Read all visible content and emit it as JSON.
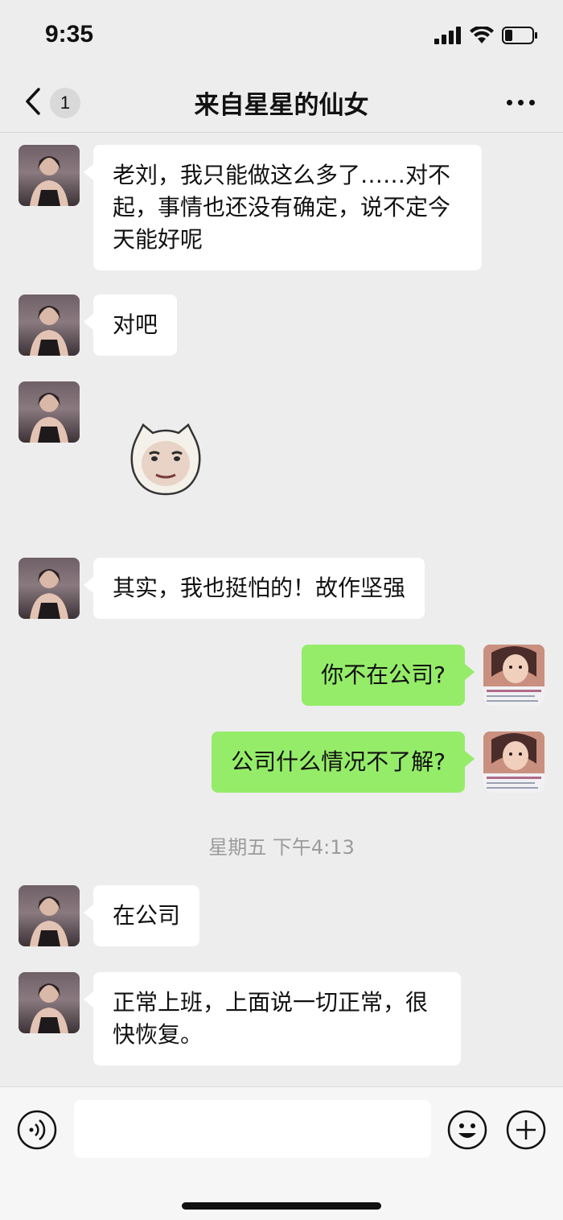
{
  "status_bar": {
    "time": "9:35"
  },
  "nav": {
    "back_count": "1",
    "title": "来自星星的仙女"
  },
  "messages": [
    {
      "side": "in",
      "text": "老刘，我只能做这么多了……对不起，事情也还没有确定，说不定今天能好呢"
    },
    {
      "side": "in",
      "text": "对吧"
    },
    {
      "side": "in",
      "type": "sticker"
    },
    {
      "side": "in",
      "text": "其实，我也挺怕的！故作坚强"
    },
    {
      "side": "out",
      "text": "你不在公司?"
    },
    {
      "side": "out",
      "text": "公司什么情况不了解?"
    },
    {
      "side": "in",
      "text": "在公司"
    },
    {
      "side": "in",
      "text": "正常上班，上面说一切正常，很快恢复。"
    }
  ],
  "timestamp": "星期五 下午4:13",
  "input": {
    "placeholder": ""
  },
  "colors": {
    "background": "#ededed",
    "bubble_out": "#95ec69",
    "bubble_in": "#ffffff"
  },
  "icons": [
    "back-icon",
    "more-icon",
    "voice-icon",
    "emoji-icon",
    "plus-icon"
  ]
}
